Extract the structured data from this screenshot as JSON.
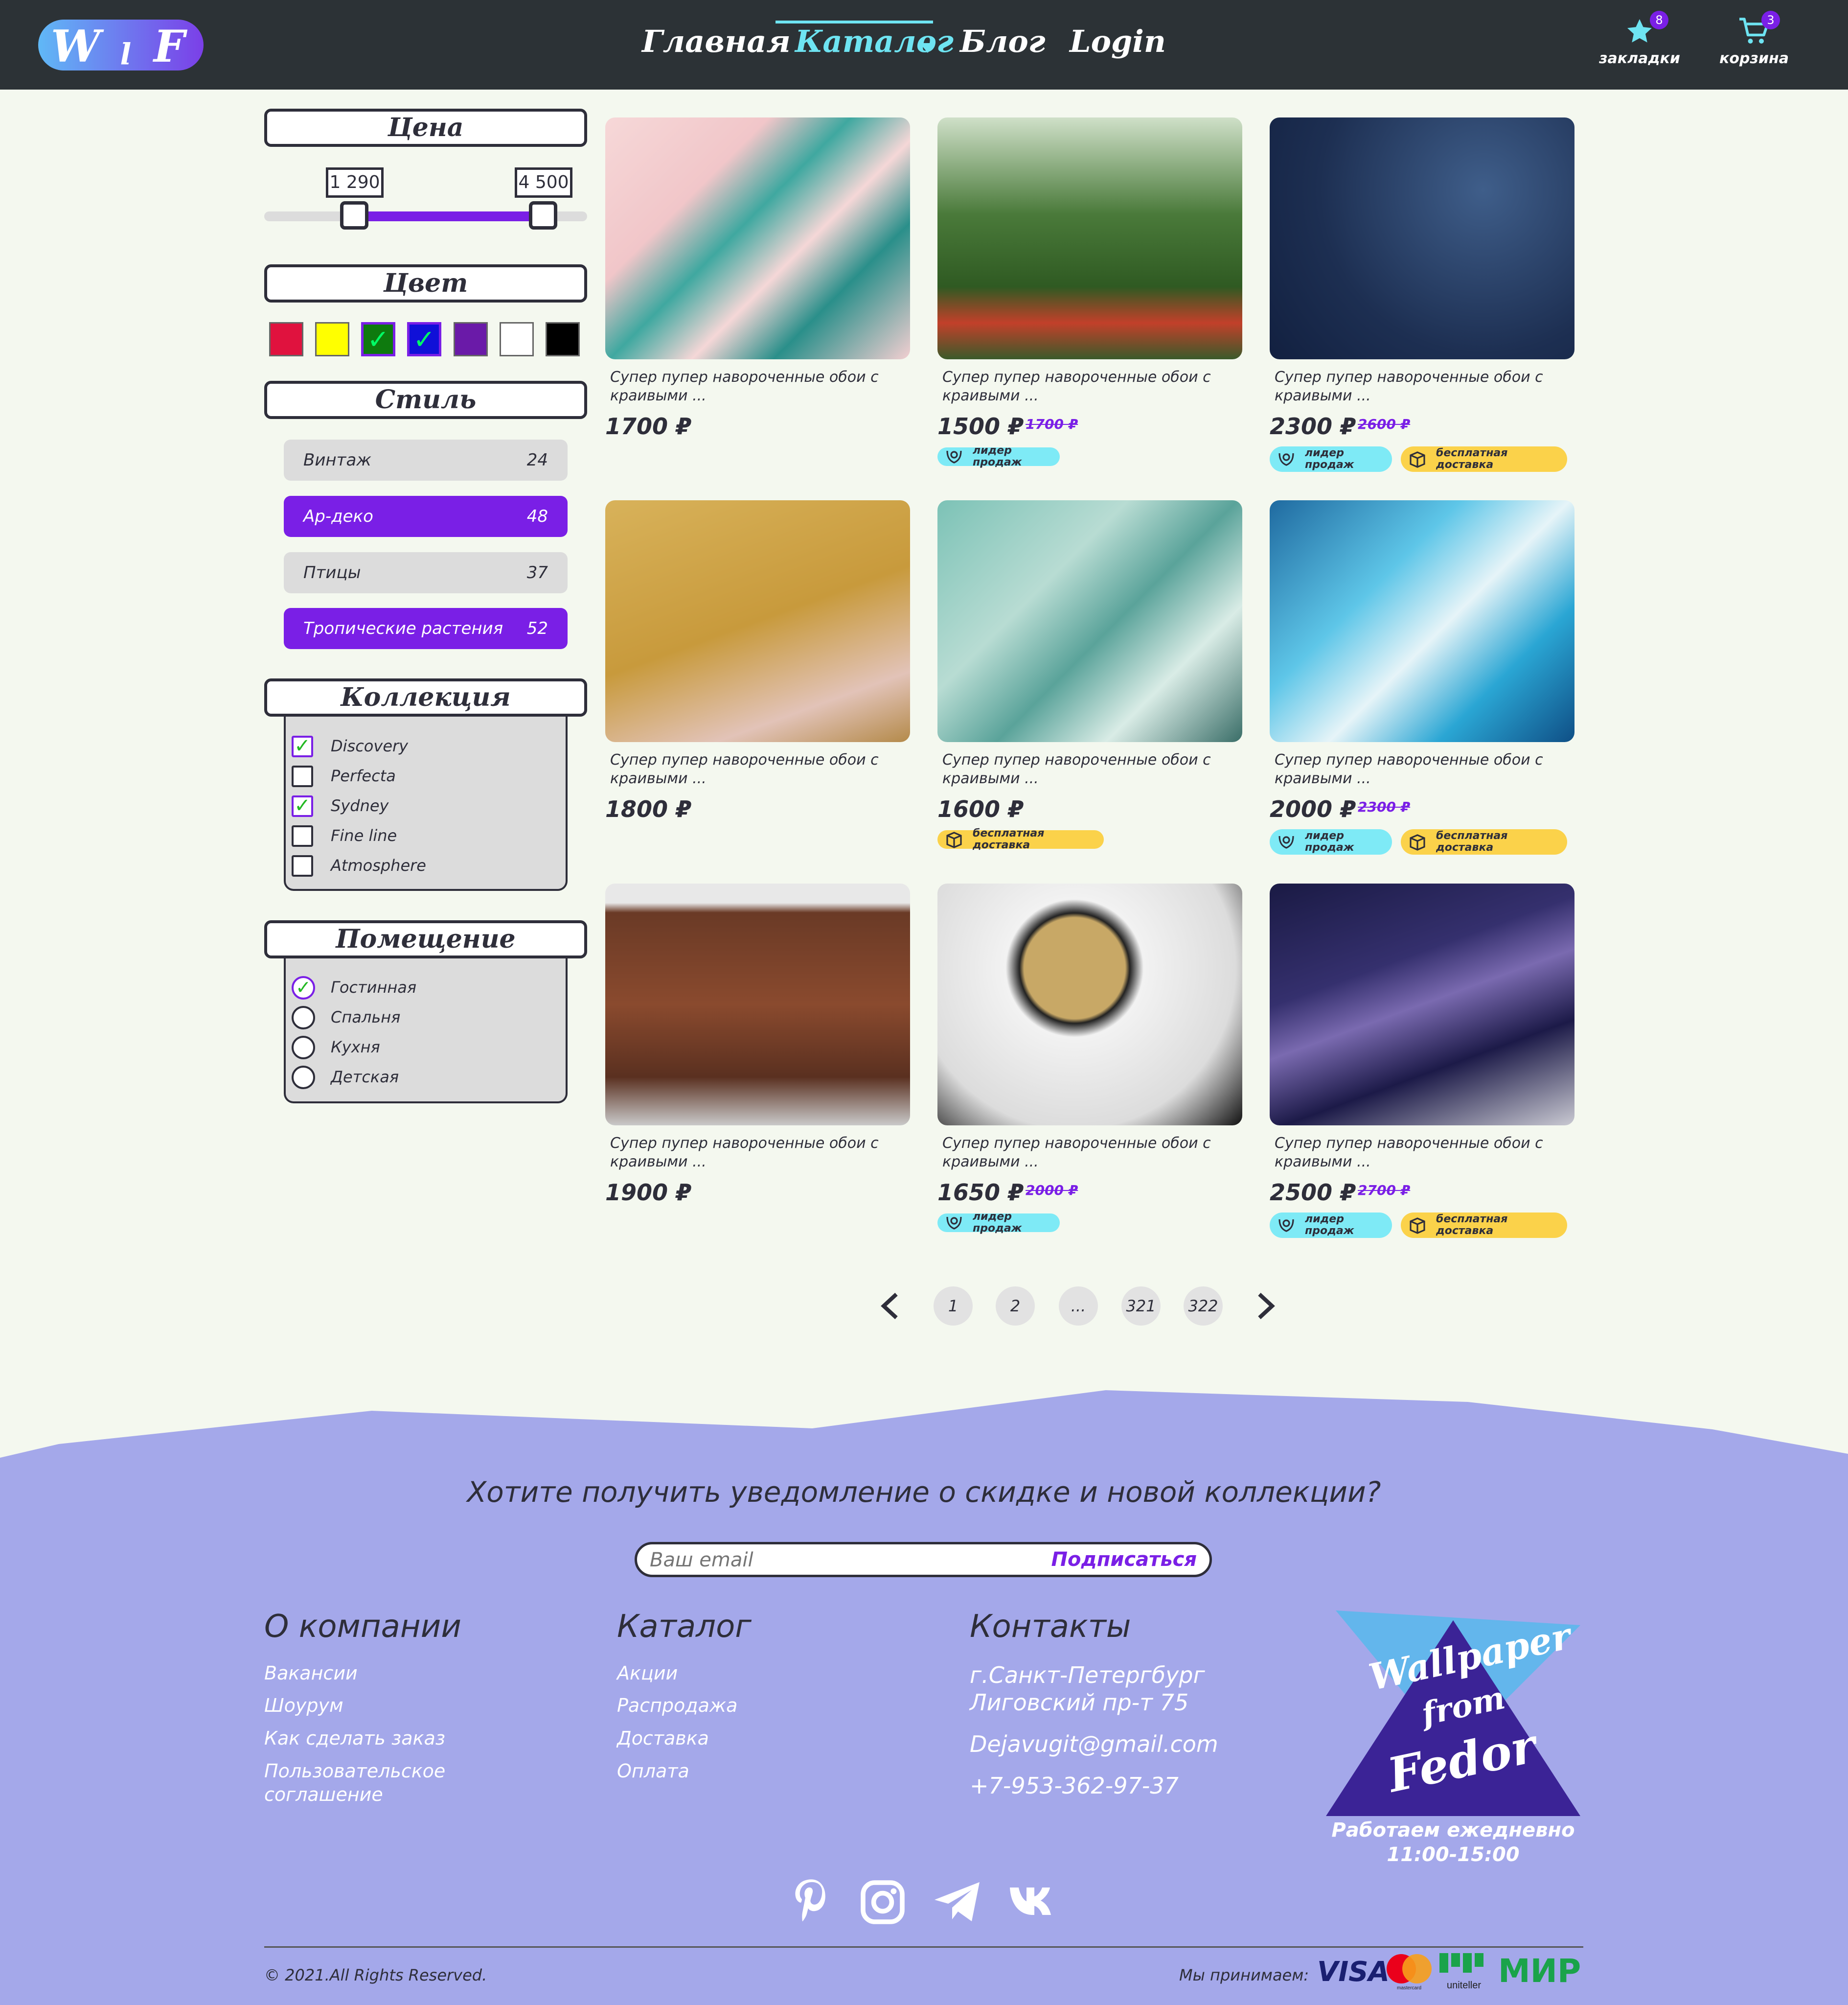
{
  "header": {
    "logo_letters": [
      "W",
      "ꞁ",
      "F"
    ],
    "nav": [
      {
        "label": "Главная",
        "active": false
      },
      {
        "label": "Каталог",
        "active": true
      },
      {
        "label": "Блог",
        "active": false
      },
      {
        "label": "Login",
        "active": false
      }
    ],
    "bookmarks": {
      "label": "закладки",
      "count": "8",
      "icon": "star-icon"
    },
    "cart": {
      "label": "корзина",
      "count": "3",
      "icon": "cart-icon"
    }
  },
  "filters": {
    "price": {
      "title": "Цена",
      "min": "1 290",
      "max": "4 500"
    },
    "color": {
      "title": "Цвет",
      "swatches": [
        {
          "color": "#e0123e",
          "checked": false
        },
        {
          "color": "#ffff00",
          "checked": false
        },
        {
          "color": "#0e7a0e",
          "checked": true
        },
        {
          "color": "#1010d8",
          "checked": true
        },
        {
          "color": "#6a1aa8",
          "checked": false
        },
        {
          "color": "#ffffff",
          "checked": false
        },
        {
          "color": "#000000",
          "checked": false
        }
      ]
    },
    "style": {
      "title": "Стиль",
      "items": [
        {
          "label": "Винтаж",
          "count": "24",
          "selected": false
        },
        {
          "label": "Ар-деко",
          "count": "48",
          "selected": true
        },
        {
          "label": "Птицы",
          "count": "37",
          "selected": false
        },
        {
          "label": "Тропические растения",
          "count": "52",
          "selected": true
        }
      ]
    },
    "collection": {
      "title": "Коллекция",
      "items": [
        {
          "label": "Discovery",
          "checked": true
        },
        {
          "label": "Perfecta",
          "checked": false
        },
        {
          "label": "Sydney",
          "checked": true
        },
        {
          "label": "Fine line",
          "checked": false
        },
        {
          "label": "Atmosphere",
          "checked": false
        }
      ]
    },
    "room": {
      "title": "Помещение",
      "items": [
        {
          "label": "Гостинная",
          "checked": true
        },
        {
          "label": "Спальня",
          "checked": false
        },
        {
          "label": "Кухня",
          "checked": false
        },
        {
          "label": "Детская",
          "checked": false
        }
      ]
    }
  },
  "products": [
    {
      "desc": "Супер пупер навороченные обои с краивыми ...",
      "price": "1700 ₽",
      "old_price": "",
      "tags": []
    },
    {
      "desc": "Супер пупер навороченные обои с краивыми ...",
      "price": "1500 ₽",
      "old_price": "1700 ₽",
      "tags": [
        "лидер продаж"
      ]
    },
    {
      "desc": "Супер пупер навороченные обои с краивыми ...",
      "price": "2300 ₽",
      "old_price": "2600 ₽",
      "tags": [
        "лидер продаж",
        "бесплатная доставка"
      ]
    },
    {
      "desc": "Супер пупер навороченные обои с краивыми ...",
      "price": "1800 ₽",
      "old_price": "",
      "tags": []
    },
    {
      "desc": "Супер пупер навороченные обои с краивыми ...",
      "price": "1600 ₽",
      "old_price": "",
      "tags": [
        "бесплатная доставка"
      ]
    },
    {
      "desc": "Супер пупер навороченные обои с краивыми ...",
      "price": "2000 ₽",
      "old_price": "2300 ₽",
      "tags": [
        "лидер продаж",
        "бесплатная доставка"
      ]
    },
    {
      "desc": "Супер пупер навороченные обои с краивыми ...",
      "price": "1900 ₽",
      "old_price": "",
      "tags": []
    },
    {
      "desc": "Супер пупер навороченные обои с краивыми ...",
      "price": "1650 ₽",
      "old_price": "2000 ₽",
      "tags": [
        "лидер продаж"
      ]
    },
    {
      "desc": "Супер пупер навороченные обои с краивыми ...",
      "price": "2500 ₽",
      "old_price": "2700 ₽",
      "tags": [
        "лидер продаж",
        "бесплатная доставка"
      ]
    }
  ],
  "pagination": {
    "pages": [
      "1",
      "2",
      "...",
      "321",
      "322"
    ]
  },
  "footer": {
    "subscribe_heading": "Хотите получить уведомление о скидке и новой коллекции?",
    "email_placeholder": "Ваш email",
    "subscribe_label": "Подписаться",
    "about": {
      "title": "О компании",
      "links": [
        "Вакансии",
        "Шоурум",
        "Как сделать заказ",
        "Пользовательское соглашение"
      ]
    },
    "catalog": {
      "title": "Каталог",
      "links": [
        "Акции",
        "Распродажа",
        "Доставка",
        "Оплата"
      ]
    },
    "contacts": {
      "title": "Контакты",
      "address": "г.Санкт-Петергбург Лиговский пр-т 75",
      "email": "Dejavugit@gmail.com",
      "phone": "+7-953-362-97-37"
    },
    "brand": {
      "line1": "Wallpaper",
      "line2": "from",
      "line3": "Fedor",
      "hours_line1": "Работаем ежедневно",
      "hours_line2": "11:00-15:00"
    },
    "social": [
      "pinterest-icon",
      "instagram-icon",
      "telegram-icon",
      "vk-icon"
    ],
    "copyright": "© 2021.All Rights Reserved.",
    "payments_label": "Мы принимаем:",
    "payments": [
      "VISA",
      "mastercard",
      "uniteller",
      "МИР"
    ]
  }
}
